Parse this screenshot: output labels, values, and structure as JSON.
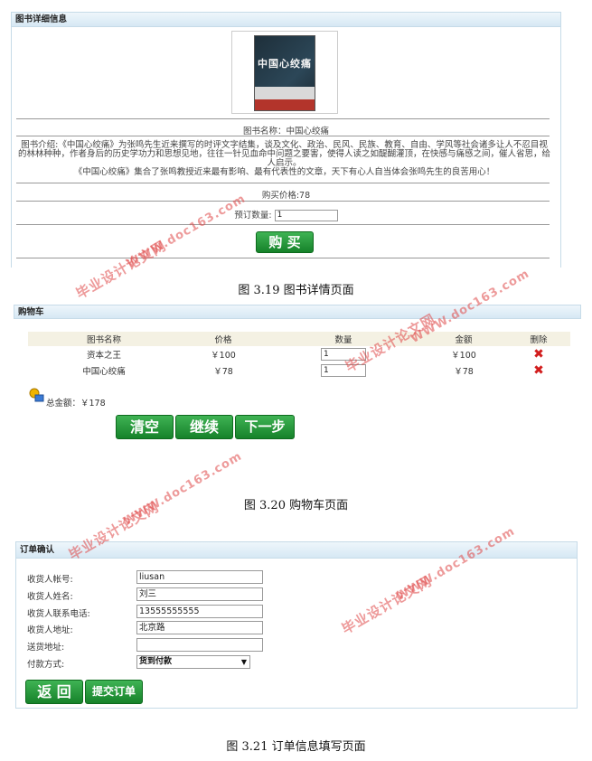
{
  "book_detail": {
    "panel_title": "图书详细信息",
    "cover_title": "中国心绞痛",
    "name_line": "图书名称：中国心绞痛",
    "intro_p1": "图书介绍:《中国心绞痛》为张鸣先生近来撰写的时评文字结集，谈及文化、政治、民风、民族、教育、自由、学风等社会诸多让人不忍目视的林林种种，作者身后的历史学功力和思想见地，往往一针见血命中问题之要害，使得人读之如醍醐灌顶，在快感与痛感之间，催人省思，给人启示。",
    "intro_p2": "《中国心绞痛》集合了张鸣教授近来最有影响、最有代表性的文章，天下有心人自当体会张鸣先生的良苦用心！",
    "price_line": "购买价格:78",
    "qty_label": "预订数量:",
    "qty_value": "1",
    "buy_label": "购 买"
  },
  "captions": {
    "fig19": "图 3.19 图书详情页面",
    "fig20": "图 3.20 购物车页面",
    "fig21": "图 3.21 订单信息填写页面"
  },
  "cart": {
    "panel_title": "购物车",
    "columns": [
      "图书名称",
      "价格",
      "数量",
      "金额",
      "删除"
    ],
    "rows": [
      {
        "name": "资本之王",
        "price": "￥100",
        "qty": "1",
        "amount": "￥100"
      },
      {
        "name": "中国心绞痛",
        "price": "￥78",
        "qty": "1",
        "amount": "￥78"
      }
    ],
    "total_label": "总金额：￥178",
    "buttons": {
      "clear": "清空",
      "continue": "继续",
      "next": "下一步"
    }
  },
  "order": {
    "panel_title": "订单确认",
    "fields": [
      {
        "label": "收货人帐号:",
        "value": "liusan"
      },
      {
        "label": "收货人姓名:",
        "value": "刘三"
      },
      {
        "label": "收货人联系电话:",
        "value": "13555555555"
      },
      {
        "label": "收货人地址:",
        "value": "北京路"
      },
      {
        "label": "送货地址:",
        "value": ""
      }
    ],
    "payment_label": "付款方式:",
    "payment_value": "货到付款",
    "back_label": "返 回",
    "submit_label": "提交订单"
  },
  "watermark": {
    "cn": "毕业设计论文网",
    "url": "WWW.doc163.com"
  },
  "colors": {
    "panel_border": "#c6dbe8",
    "button_green": "#16822a",
    "delete_red": "#d21d1d",
    "watermark_red": "#e04848"
  }
}
